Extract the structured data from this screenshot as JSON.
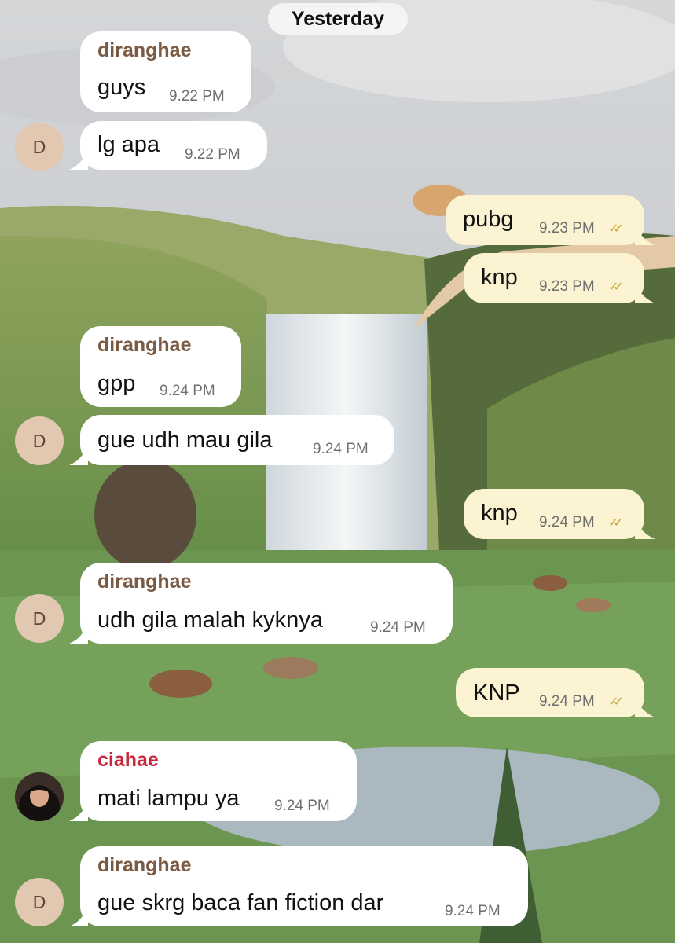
{
  "date_chip": "Yesterday",
  "messages": [
    {
      "sender": "diranghae",
      "text": "guys",
      "time": "9.22 PM"
    },
    {
      "text": "lg apa",
      "time": "9.22 PM",
      "avatar": "D"
    },
    {
      "text": "pubg",
      "time": "9.23 PM",
      "read": "✓✓"
    },
    {
      "text": "knp",
      "time": "9.23 PM",
      "read": "✓✓"
    },
    {
      "sender": "diranghae",
      "text": "gpp",
      "time": "9.24 PM"
    },
    {
      "text": "gue udh mau gila",
      "time": "9.24 PM",
      "avatar": "D"
    },
    {
      "text": "knp",
      "time": "9.24 PM",
      "read": "✓✓"
    },
    {
      "sender": "diranghae",
      "text": "udh gila malah kyknya",
      "time": "9.24 PM",
      "avatar": "D"
    },
    {
      "text": "KNP",
      "time": "9.24 PM",
      "read": "✓✓"
    },
    {
      "sender": "ciahae",
      "text": "mati lampu ya",
      "time": "9.24 PM",
      "avatar": "photo"
    },
    {
      "sender": "diranghae",
      "text": "gue skrg baca fan fiction dar",
      "time": "9.24 PM",
      "avatar": "D"
    }
  ],
  "colors": {
    "incoming_bubble": "#ffffff",
    "outgoing_bubble": "#fbf3d2",
    "sender_diranghae": "#7b5a44",
    "sender_ciahae": "#c9273d",
    "read_checks": "#c6a531",
    "avatar_bg": "#e2c7b1"
  },
  "wallpaper": "landscape-waterfall-cats"
}
